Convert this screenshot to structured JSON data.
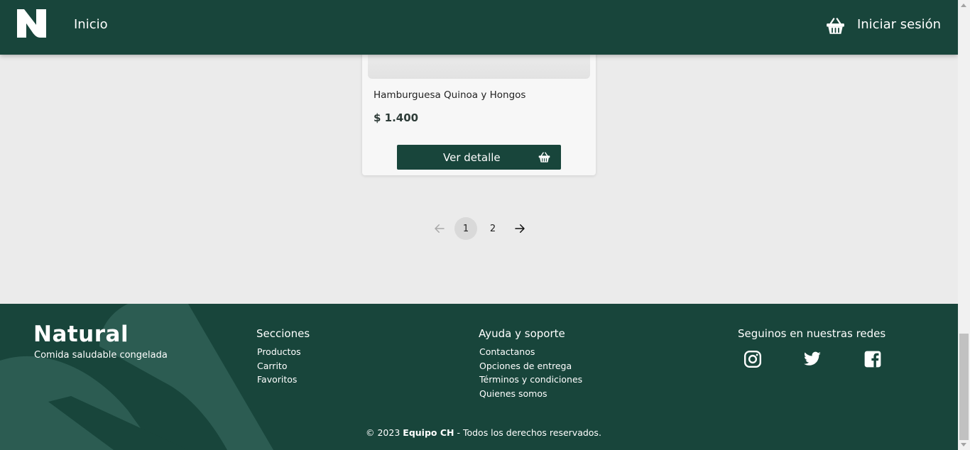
{
  "navbar": {
    "logo_icon": "natural-n-logo",
    "home_label": "Inicio",
    "cart_icon": "shopping-basket-icon",
    "login_label": "Iniciar sesión",
    "bg_color": "#18453b"
  },
  "product": {
    "name": "Hamburguesa Quinoa y Hongos",
    "price": "$ 1.400",
    "detail_label": "Ver detalle",
    "detail_icon": "basket-icon"
  },
  "pagination": {
    "prev_icon": "arrow-left-icon",
    "pages": [
      "1",
      "2"
    ],
    "current_page": "1",
    "next_icon": "arrow-right-icon"
  },
  "footer": {
    "brand": "Natural",
    "tagline": "Comida saludable congelada",
    "sections_title": "Secciones",
    "sections": [
      "Productos",
      "Carrito",
      "Favoritos"
    ],
    "help_title": "Ayuda y soporte",
    "help": [
      "Contactanos",
      "Opciones de entrega",
      "Términos y condiciones",
      "Quienes somos"
    ],
    "social_title": "Seguinos en nuestras redes",
    "social_icons": [
      "instagram-icon",
      "twitter-icon",
      "facebook-icon"
    ],
    "copyright_prefix": "© 2023",
    "copyright_team": "Equipo CH",
    "copyright_suffix": "- Todos los derechos reservados."
  },
  "colors": {
    "primary": "#18453b",
    "background": "#ebebeb",
    "card": "#f7f7f7"
  }
}
